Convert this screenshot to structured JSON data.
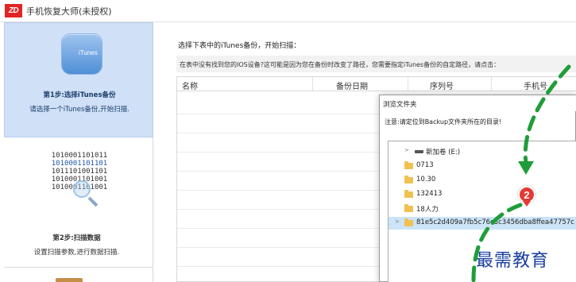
{
  "app": {
    "logo_text": "ZD",
    "title": "手机恢复大师(未授权)"
  },
  "sidebar": {
    "step1": {
      "icon_label": "iTunes",
      "title": "第1步:选择iTunes备份",
      "description": "请选择一个iTunes备份,开始扫描."
    },
    "binary_lines": [
      "1010001101011",
      "1010001101101",
      "1011101001101",
      "1010001101001",
      "1010001101001"
    ],
    "step2": {
      "title": "第2步:扫描数据",
      "description": "设置扫描参数,进行数据扫描."
    }
  },
  "main": {
    "prompt": "选择下表中的iTunes备份，开始扫描：",
    "notice": "在表中没有找到您的IOS设备?这可能是因为您在备份时改变了路径，您需要指定iTunes备份的自定路径，请点击：",
    "table": {
      "columns": [
        "名称",
        "备份日期",
        "序列号",
        "手机号"
      ]
    }
  },
  "dialog": {
    "title": "浏览文件夹",
    "note": "注意:请定位到Backup文件夹所在的目录!",
    "tree": [
      {
        "label": "新加卷 (E:)",
        "type": "drive",
        "expanded": true
      },
      {
        "label": "0713",
        "type": "folder"
      },
      {
        "label": "10.30",
        "type": "folder"
      },
      {
        "label": "132413",
        "type": "folder"
      },
      {
        "label": "18人力",
        "type": "folder"
      },
      {
        "label": "81e5c2d409a7fb5c76c3c3456dba8ffea47757c",
        "type": "folder",
        "selected": true
      }
    ]
  },
  "annotation": {
    "badge_number": "2",
    "watermark": "最需教育",
    "arrow_color": "#1f9d3a",
    "badge_color": "#e53935"
  }
}
